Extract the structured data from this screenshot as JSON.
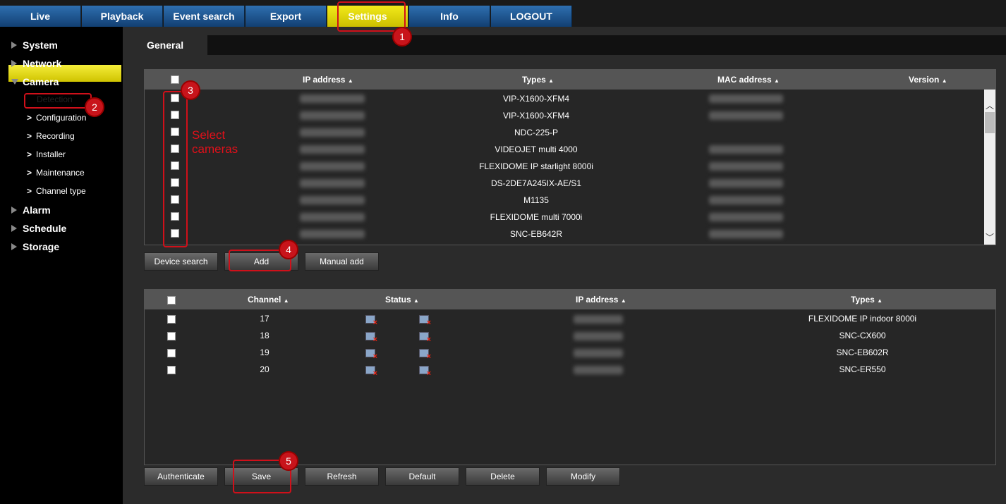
{
  "nav": {
    "tabs": [
      {
        "label": "Live"
      },
      {
        "label": "Playback"
      },
      {
        "label": "Event search"
      },
      {
        "label": "Export"
      },
      {
        "label": "Settings"
      },
      {
        "label": "Info"
      },
      {
        "label": "LOGOUT"
      }
    ],
    "active": "Settings",
    "active_color": "#e8de10",
    "tab_color": "#1f5a97"
  },
  "sidebar": {
    "items": [
      {
        "label": "System",
        "expanded": false
      },
      {
        "label": "Network",
        "expanded": false
      },
      {
        "label": "Camera",
        "expanded": true
      },
      {
        "label": "Alarm",
        "expanded": false
      },
      {
        "label": "Schedule",
        "expanded": false
      },
      {
        "label": "Storage",
        "expanded": false
      }
    ],
    "camera_sub": [
      "Detection",
      "Configuration",
      "Recording",
      "Installer",
      "Maintenance",
      "Channel type"
    ],
    "sub_chevron": ">",
    "active_sub": "Detection"
  },
  "general_tab": "General",
  "detected": {
    "headers": [
      "IP address",
      "Types",
      "MAC address",
      "Version"
    ],
    "rows": [
      {
        "type": "VIP-X1600-XFM4",
        "has_mac": true
      },
      {
        "type": "VIP-X1600-XFM4",
        "has_mac": true
      },
      {
        "type": "NDC-225-P",
        "has_mac": false
      },
      {
        "type": "VIDEOJET multi 4000",
        "has_mac": true
      },
      {
        "type": "FLEXIDOME IP starlight 8000i",
        "has_mac": true
      },
      {
        "type": "DS-2DE7A245IX-AE/S1",
        "has_mac": true
      },
      {
        "type": "M1135",
        "has_mac": true
      },
      {
        "type": "FLEXIDOME multi 7000i",
        "has_mac": true
      },
      {
        "type": "SNC-EB642R",
        "has_mac": true
      }
    ]
  },
  "detected_buttons": [
    "Device search",
    "Add",
    "Manual add"
  ],
  "channels": {
    "headers": [
      "Channel",
      "Status",
      "IP address",
      "Types"
    ],
    "rows": [
      {
        "channel": "17",
        "type": "FLEXIDOME IP indoor 8000i"
      },
      {
        "channel": "18",
        "type": "SNC-CX600"
      },
      {
        "channel": "19",
        "type": "SNC-EB602R"
      },
      {
        "channel": "20",
        "type": "SNC-ER550"
      }
    ]
  },
  "bottom_buttons": [
    "Authenticate",
    "Save",
    "Refresh",
    "Default",
    "Delete",
    "Modify"
  ],
  "annotations": {
    "numbers": [
      "1",
      "2",
      "3",
      "4",
      "5"
    ],
    "select_text": "Select cameras",
    "color": "#d0101a"
  },
  "sort_arrow": "▲"
}
